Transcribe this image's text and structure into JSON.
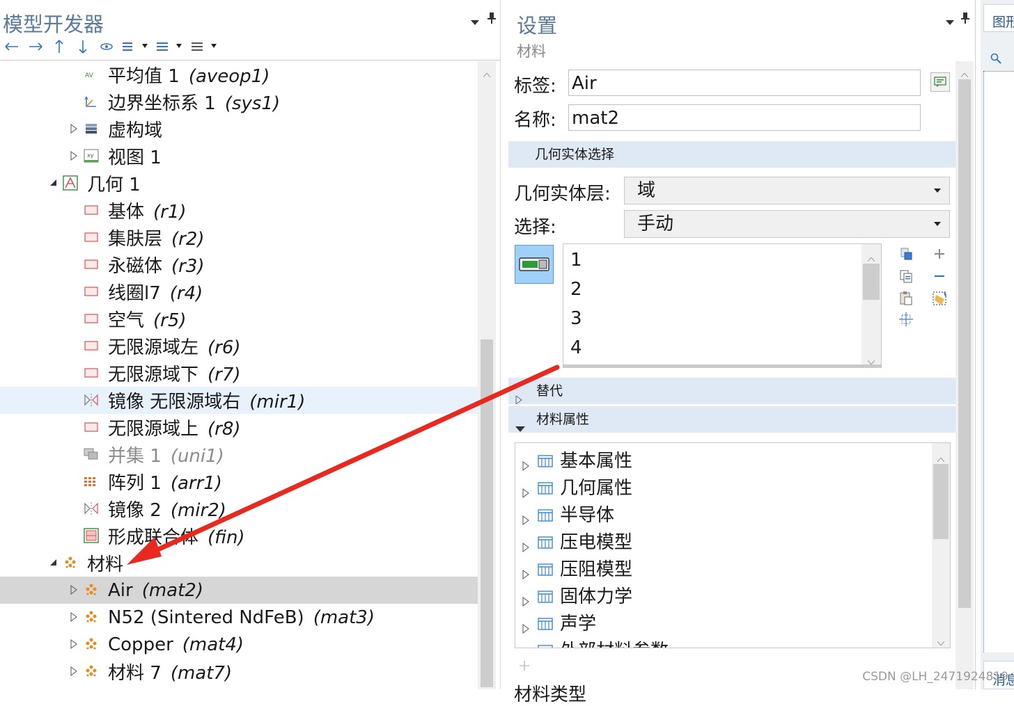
{
  "model_builder": {
    "title": "模型开发器",
    "tree": [
      {
        "label": "平均值 1",
        "tag": "(aveop1)",
        "icon": "average-icon",
        "indent": 2,
        "expander": "none"
      },
      {
        "label": "边界坐标系 1",
        "tag": "(sys1)",
        "icon": "coordinate-system-icon",
        "indent": 2,
        "expander": "none"
      },
      {
        "label": "虚构域",
        "tag": "",
        "icon": "layers-icon",
        "indent": 2,
        "expander": "collapsed"
      },
      {
        "label": "视图 1",
        "tag": "",
        "icon": "view-icon",
        "indent": 2,
        "expander": "collapsed"
      },
      {
        "label": "几何 1",
        "tag": "",
        "icon": "geometry-icon",
        "indent": 1,
        "expander": "expanded"
      },
      {
        "label": "基体",
        "tag": "(r1)",
        "icon": "rectangle-icon",
        "indent": 2,
        "expander": "none"
      },
      {
        "label": "集肤层",
        "tag": "(r2)",
        "icon": "rectangle-icon",
        "indent": 2,
        "expander": "none"
      },
      {
        "label": "永磁体",
        "tag": "(r3)",
        "icon": "rectangle-icon",
        "indent": 2,
        "expander": "none"
      },
      {
        "label": "线圈l7",
        "tag": "(r4)",
        "icon": "rectangle-icon",
        "indent": 2,
        "expander": "none"
      },
      {
        "label": "空气",
        "tag": "(r5)",
        "icon": "rectangle-icon",
        "indent": 2,
        "expander": "none"
      },
      {
        "label": "无限源域左",
        "tag": "(r6)",
        "icon": "rectangle-icon",
        "indent": 2,
        "expander": "none"
      },
      {
        "label": "无限源域下",
        "tag": "(r7)",
        "icon": "rectangle-icon",
        "indent": 2,
        "expander": "none"
      },
      {
        "label": "镜像 无限源域右",
        "tag": "(mir1)",
        "icon": "mirror-icon",
        "indent": 2,
        "expander": "none",
        "state": "hover"
      },
      {
        "label": "无限源域上",
        "tag": "(r8)",
        "icon": "rectangle-icon",
        "indent": 2,
        "expander": "none"
      },
      {
        "label": "并集 1",
        "tag": "(uni1)",
        "icon": "union-icon",
        "indent": 2,
        "expander": "none",
        "disabled": true
      },
      {
        "label": "阵列 1",
        "tag": "(arr1)",
        "icon": "array-icon",
        "indent": 2,
        "expander": "none"
      },
      {
        "label": "镜像 2",
        "tag": "(mir2)",
        "icon": "mirror-icon",
        "indent": 2,
        "expander": "none"
      },
      {
        "label": "形成联合体",
        "tag": "(fin)",
        "icon": "form-union-icon",
        "indent": 2,
        "expander": "none"
      },
      {
        "label": "材料",
        "tag": "",
        "icon": "materials-icon",
        "indent": 1,
        "expander": "expanded"
      },
      {
        "label": "Air",
        "tag": "(mat2)",
        "icon": "material-icon",
        "indent": 2,
        "expander": "collapsed",
        "state": "selected"
      },
      {
        "label": "N52 (Sintered NdFeB)",
        "tag": "(mat3)",
        "icon": "material-icon",
        "indent": 2,
        "expander": "collapsed"
      },
      {
        "label": "Copper",
        "tag": "(mat4)",
        "icon": "material-icon",
        "indent": 2,
        "expander": "collapsed"
      },
      {
        "label": "材料 7",
        "tag": "(mat7)",
        "icon": "material-icon",
        "indent": 2,
        "expander": "collapsed"
      }
    ]
  },
  "settings": {
    "title": "设置",
    "subtitle": "材料",
    "label_caption": "标签:",
    "label_value": "Air",
    "name_caption": "名称:",
    "name_value": "mat2",
    "geom_section": "几何实体选择",
    "geom_level_caption": "几何实体层:",
    "geom_level_value": "域",
    "selection_caption": "选择:",
    "selection_value": "手动",
    "selection_items": [
      "1",
      "2",
      "3",
      "4"
    ],
    "override_section": "替代",
    "props_section": "材料属性",
    "properties": [
      "基本属性",
      "几何属性",
      "半导体",
      "压电模型",
      "压阻模型",
      "固体力学",
      "声学",
      "外部材料参数"
    ],
    "material_type_caption": "材料类型"
  },
  "graphics": {
    "tab_label": "图形",
    "messages_label": "消息"
  },
  "watermark": "CSDN @LH_2471924819",
  "colors": {
    "accent": "#5b7a99",
    "section_bg": "#dfe9f5",
    "selected_row": "#d6d6d6",
    "hover_row": "#e8f2fd",
    "arrow_annotation": "#e8291f",
    "material_orange": "#e88a1a",
    "geometry_red": "#d9534f",
    "property_blue": "#3a8ad6"
  }
}
